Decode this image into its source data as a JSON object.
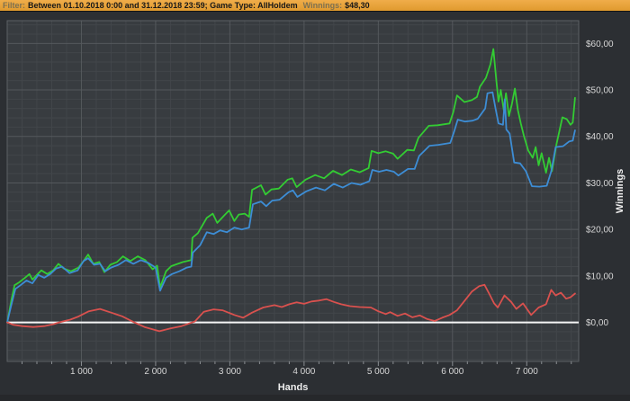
{
  "header": {
    "filter_label": "Filter:",
    "filter_value": "Between 01.10.2018 0:00 and 31.12.2018 23:59; Game Type: AllHoldem",
    "winnings_label": "Winnings:",
    "winnings_value": "$48,30",
    "bar_color": "#e8a23c"
  },
  "chart_data": {
    "type": "line",
    "title": "",
    "xlabel": "Hands",
    "ylabel": "Winnings",
    "xlim": [
      0,
      7700
    ],
    "ylim": [
      -8.4,
      64.9
    ],
    "grid": true,
    "legend": "none",
    "x_major_ticks": [
      1000,
      2000,
      3000,
      4000,
      5000,
      6000,
      7000
    ],
    "x_tick_labels": [
      "1 000",
      "2 000",
      "3 000",
      "4 000",
      "5 000",
      "6 000",
      "7 000"
    ],
    "x_minor_step": 200,
    "y_major_ticks": [
      0,
      10,
      20,
      30,
      40,
      50,
      60
    ],
    "y_tick_labels": [
      "$0,00",
      "$10,00",
      "$20,00",
      "$30,00",
      "$40,00",
      "$50,00",
      "$60,00"
    ],
    "y_minor_step": 2,
    "zero_line": {
      "value": 0,
      "color": "#f5f5f5"
    },
    "colors": {
      "plot_bg": "#383c40",
      "outer_bg": "#2c2f33",
      "grid_minor": "#42464a",
      "grid_major": "#54585c",
      "border": "#5c6064",
      "tick_label": "#d6d6d6",
      "axis_title": "#eeeeee"
    },
    "series": [
      {
        "name": "green-line",
        "color": "#33cc33",
        "points": [
          [
            0,
            0
          ],
          [
            30,
            2.5
          ],
          [
            60,
            5
          ],
          [
            100,
            8
          ],
          [
            160,
            8.6
          ],
          [
            240,
            9.6
          ],
          [
            300,
            10.4
          ],
          [
            340,
            9.2
          ],
          [
            400,
            10.2
          ],
          [
            460,
            11.2
          ],
          [
            540,
            10.4
          ],
          [
            620,
            11.2
          ],
          [
            690,
            12.6
          ],
          [
            760,
            11.6
          ],
          [
            860,
            11
          ],
          [
            960,
            11.8
          ],
          [
            1030,
            13.2
          ],
          [
            1090,
            14.6
          ],
          [
            1160,
            12.6
          ],
          [
            1240,
            13
          ],
          [
            1310,
            10.8
          ],
          [
            1390,
            12.4
          ],
          [
            1480,
            13
          ],
          [
            1560,
            14.2
          ],
          [
            1660,
            13.2
          ],
          [
            1760,
            14.2
          ],
          [
            1860,
            13.4
          ],
          [
            1960,
            11.4
          ],
          [
            2020,
            12.2
          ],
          [
            2060,
            7.5
          ],
          [
            2140,
            11
          ],
          [
            2210,
            12.1
          ],
          [
            2300,
            12.6
          ],
          [
            2370,
            13
          ],
          [
            2480,
            13.4
          ],
          [
            2495,
            18.2
          ],
          [
            2570,
            19.2
          ],
          [
            2690,
            22.5
          ],
          [
            2770,
            23.4
          ],
          [
            2830,
            21.4
          ],
          [
            2930,
            23.1
          ],
          [
            2990,
            24.1
          ],
          [
            3060,
            21.8
          ],
          [
            3120,
            23.2
          ],
          [
            3200,
            23.4
          ],
          [
            3260,
            22.7
          ],
          [
            3300,
            28.5
          ],
          [
            3420,
            29.5
          ],
          [
            3480,
            27.5
          ],
          [
            3560,
            28.6
          ],
          [
            3660,
            28.8
          ],
          [
            3780,
            30.7
          ],
          [
            3840,
            31
          ],
          [
            3900,
            29.1
          ],
          [
            4020,
            30.7
          ],
          [
            4150,
            31.7
          ],
          [
            4270,
            31
          ],
          [
            4390,
            32.6
          ],
          [
            4510,
            31.7
          ],
          [
            4630,
            32.9
          ],
          [
            4750,
            32.3
          ],
          [
            4870,
            33.2
          ],
          [
            4910,
            36.9
          ],
          [
            5000,
            36.4
          ],
          [
            5100,
            36.8
          ],
          [
            5200,
            36.3
          ],
          [
            5260,
            35.2
          ],
          [
            5390,
            37.1
          ],
          [
            5480,
            37
          ],
          [
            5540,
            39.7
          ],
          [
            5680,
            42.3
          ],
          [
            5800,
            42.4
          ],
          [
            5960,
            42.8
          ],
          [
            6010,
            45.2
          ],
          [
            6060,
            48.8
          ],
          [
            6160,
            47.4
          ],
          [
            6260,
            47.8
          ],
          [
            6330,
            48.5
          ],
          [
            6370,
            50.7
          ],
          [
            6450,
            52.6
          ],
          [
            6510,
            55.5
          ],
          [
            6550,
            58.8
          ],
          [
            6590,
            52
          ],
          [
            6620,
            47.5
          ],
          [
            6650,
            50
          ],
          [
            6690,
            45.7
          ],
          [
            6720,
            49.3
          ],
          [
            6760,
            44.4
          ],
          [
            6800,
            47
          ],
          [
            6840,
            50.3
          ],
          [
            6880,
            45.7
          ],
          [
            6920,
            42.8
          ],
          [
            6960,
            40.2
          ],
          [
            7020,
            37
          ],
          [
            7080,
            35.4
          ],
          [
            7120,
            37.7
          ],
          [
            7160,
            33.8
          ],
          [
            7200,
            36.4
          ],
          [
            7260,
            32.2
          ],
          [
            7300,
            35.4
          ],
          [
            7340,
            32.5
          ],
          [
            7400,
            38.3
          ],
          [
            7440,
            41.2
          ],
          [
            7480,
            44.1
          ],
          [
            7540,
            43.7
          ],
          [
            7590,
            42.5
          ],
          [
            7620,
            43
          ],
          [
            7650,
            48.3
          ]
        ]
      },
      {
        "name": "blue-line",
        "color": "#3d8dd5",
        "points": [
          [
            0,
            0
          ],
          [
            60,
            4
          ],
          [
            110,
            7.2
          ],
          [
            180,
            8
          ],
          [
            260,
            9
          ],
          [
            340,
            8.4
          ],
          [
            420,
            10.2
          ],
          [
            500,
            9.6
          ],
          [
            580,
            10.4
          ],
          [
            660,
            11.6
          ],
          [
            740,
            12
          ],
          [
            840,
            10.6
          ],
          [
            950,
            11.2
          ],
          [
            1030,
            13.2
          ],
          [
            1090,
            13.8
          ],
          [
            1170,
            12.4
          ],
          [
            1250,
            12.6
          ],
          [
            1320,
            11
          ],
          [
            1400,
            11.8
          ],
          [
            1500,
            12.4
          ],
          [
            1600,
            13.4
          ],
          [
            1700,
            12.6
          ],
          [
            1800,
            13.4
          ],
          [
            1900,
            12.8
          ],
          [
            2000,
            11.8
          ],
          [
            2060,
            6.8
          ],
          [
            2140,
            9.6
          ],
          [
            2220,
            10.4
          ],
          [
            2320,
            11
          ],
          [
            2420,
            11.8
          ],
          [
            2480,
            12
          ],
          [
            2500,
            15
          ],
          [
            2600,
            16.6
          ],
          [
            2690,
            19.4
          ],
          [
            2780,
            19
          ],
          [
            2870,
            19.8
          ],
          [
            2960,
            19.4
          ],
          [
            3060,
            20.4
          ],
          [
            3160,
            20
          ],
          [
            3260,
            20.4
          ],
          [
            3310,
            25.4
          ],
          [
            3420,
            26
          ],
          [
            3490,
            25
          ],
          [
            3570,
            26.2
          ],
          [
            3670,
            26.4
          ],
          [
            3790,
            28
          ],
          [
            3850,
            28.4
          ],
          [
            3910,
            27
          ],
          [
            4030,
            28.2
          ],
          [
            4160,
            29
          ],
          [
            4280,
            28.4
          ],
          [
            4400,
            29.8
          ],
          [
            4520,
            29
          ],
          [
            4640,
            30
          ],
          [
            4760,
            29.6
          ],
          [
            4880,
            30.4
          ],
          [
            4920,
            32.8
          ],
          [
            5010,
            32.4
          ],
          [
            5110,
            32.8
          ],
          [
            5210,
            32.4
          ],
          [
            5270,
            31.6
          ],
          [
            5400,
            33
          ],
          [
            5490,
            33
          ],
          [
            5550,
            35.8
          ],
          [
            5690,
            38
          ],
          [
            5810,
            38.2
          ],
          [
            5970,
            38.6
          ],
          [
            6020,
            41
          ],
          [
            6070,
            43.6
          ],
          [
            6170,
            43.2
          ],
          [
            6270,
            43.4
          ],
          [
            6340,
            43.8
          ],
          [
            6440,
            46
          ],
          [
            6470,
            49.3
          ],
          [
            6540,
            49.5
          ],
          [
            6580,
            46
          ],
          [
            6620,
            42.8
          ],
          [
            6680,
            42.5
          ],
          [
            6705,
            48
          ],
          [
            6725,
            41.5
          ],
          [
            6770,
            40.6
          ],
          [
            6830,
            34.4
          ],
          [
            6910,
            34.2
          ],
          [
            6990,
            32.5
          ],
          [
            7070,
            29.3
          ],
          [
            7170,
            29.2
          ],
          [
            7270,
            29.4
          ],
          [
            7330,
            32.5
          ],
          [
            7390,
            37.7
          ],
          [
            7490,
            37.9
          ],
          [
            7570,
            38.9
          ],
          [
            7620,
            39.1
          ],
          [
            7650,
            41.3
          ]
        ]
      },
      {
        "name": "red-line",
        "color": "#d9514e",
        "points": [
          [
            0,
            0
          ],
          [
            80,
            -0.5
          ],
          [
            200,
            -0.8
          ],
          [
            350,
            -1
          ],
          [
            500,
            -0.8
          ],
          [
            620,
            -0.4
          ],
          [
            720,
            0.1
          ],
          [
            850,
            0.6
          ],
          [
            950,
            1.2
          ],
          [
            1100,
            2.4
          ],
          [
            1250,
            2.9
          ],
          [
            1400,
            2.1
          ],
          [
            1550,
            1.3
          ],
          [
            1700,
            0.1
          ],
          [
            1850,
            -1
          ],
          [
            2050,
            -1.9
          ],
          [
            2200,
            -1.3
          ],
          [
            2350,
            -0.8
          ],
          [
            2530,
            0.2
          ],
          [
            2650,
            2.3
          ],
          [
            2780,
            2.8
          ],
          [
            2900,
            2.6
          ],
          [
            3060,
            1.6
          ],
          [
            3180,
            1
          ],
          [
            3300,
            2.1
          ],
          [
            3450,
            3.2
          ],
          [
            3600,
            3.7
          ],
          [
            3700,
            3.3
          ],
          [
            3800,
            3.9
          ],
          [
            3900,
            4.3
          ],
          [
            4000,
            4
          ],
          [
            4100,
            4.5
          ],
          [
            4200,
            4.7
          ],
          [
            4300,
            5
          ],
          [
            4400,
            4.4
          ],
          [
            4500,
            3.9
          ],
          [
            4620,
            3.5
          ],
          [
            4750,
            3.3
          ],
          [
            4900,
            3.2
          ],
          [
            5000,
            2.4
          ],
          [
            5100,
            1.8
          ],
          [
            5160,
            2.2
          ],
          [
            5260,
            1.4
          ],
          [
            5360,
            1.9
          ],
          [
            5460,
            1.1
          ],
          [
            5560,
            1.5
          ],
          [
            5660,
            0.7
          ],
          [
            5760,
            0.3
          ],
          [
            5860,
            1
          ],
          [
            5960,
            1.6
          ],
          [
            6060,
            2.6
          ],
          [
            6160,
            4.6
          ],
          [
            6260,
            6.6
          ],
          [
            6360,
            7.8
          ],
          [
            6430,
            8.1
          ],
          [
            6500,
            6
          ],
          [
            6560,
            4.1
          ],
          [
            6610,
            3.2
          ],
          [
            6700,
            5.8
          ],
          [
            6790,
            4.4
          ],
          [
            6860,
            2.9
          ],
          [
            6950,
            4.1
          ],
          [
            7060,
            1.6
          ],
          [
            7160,
            3.2
          ],
          [
            7260,
            3.9
          ],
          [
            7330,
            7
          ],
          [
            7390,
            5.8
          ],
          [
            7460,
            6.4
          ],
          [
            7530,
            5.1
          ],
          [
            7590,
            5.4
          ],
          [
            7650,
            6.2
          ]
        ]
      }
    ]
  }
}
